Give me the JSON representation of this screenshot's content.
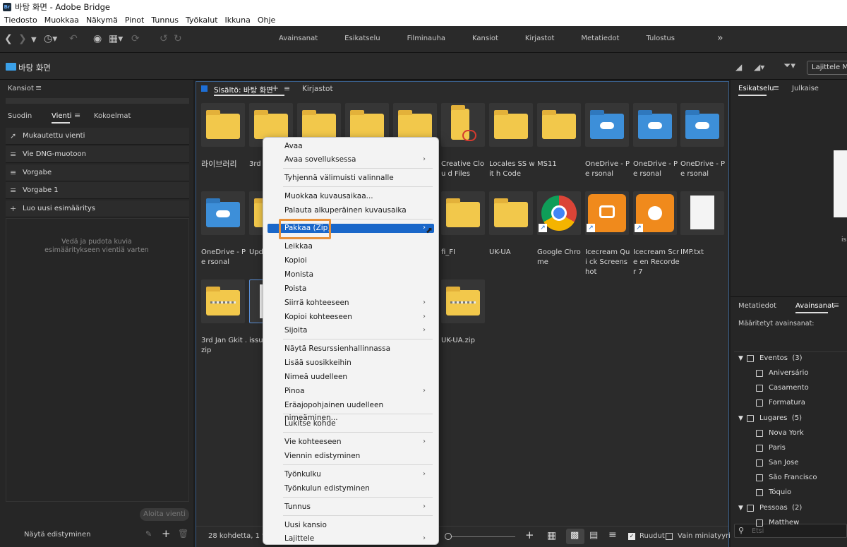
{
  "window": {
    "title": "바탕 화면 - Adobe Bridge",
    "app_icon": "Br"
  },
  "menubar": [
    "Tiedosto",
    "Muokkaa",
    "Näkymä",
    "Pinot",
    "Tunnus",
    "Työkalut",
    "Ikkuna",
    "Ohje"
  ],
  "workspaces": [
    "Avainsanat",
    "Esikatselu",
    "Filminauha",
    "Kansiot",
    "Kirjastot",
    "Metatiedot",
    "Tulostus"
  ],
  "path": {
    "current": "바탕 화면",
    "sort_label": "Lajittele Ma"
  },
  "left": {
    "folders_tab": "Kansiot",
    "tabs": [
      "Suodin",
      "Vienti",
      "Kokoelmat"
    ],
    "export_items": [
      "Mukautettu vienti",
      "Vie DNG-muotoon",
      "Vorgabe",
      "Vorgabe 1",
      "Luo uusi esimääritys"
    ],
    "drop_hint_1": "Vedä ja pudota kuvia",
    "drop_hint_2": "esimääritykseen vientiä varten",
    "start_export": "Aloita vienti",
    "show_progress": "Näytä edistyminen"
  },
  "content": {
    "tab_title": "Sisältö: 바탕 화면",
    "tab_libraries": "Kirjastot",
    "items": [
      {
        "name": "라이브러리",
        "kind": "folder"
      },
      {
        "name": "3rd J",
        "kind": "folder"
      },
      {
        "name": "",
        "kind": "folder"
      },
      {
        "name": "",
        "kind": "folder"
      },
      {
        "name": "",
        "kind": "folder"
      },
      {
        "name": "Creative Clou d Files",
        "kind": "cc-folder"
      },
      {
        "name": "Locales SS wit h Code",
        "kind": "folder"
      },
      {
        "name": "MS11",
        "kind": "folder"
      },
      {
        "name": "OneDrive - Pe rsonal",
        "kind": "onedrive"
      },
      {
        "name": "OneDrive - Pe rsonal",
        "kind": "onedrive"
      },
      {
        "name": "OneDrive - Pe rsonal",
        "kind": "onedrive"
      },
      {
        "name": "OneDrive - Pe rsonal",
        "kind": "onedrive"
      },
      {
        "name": "Upd",
        "kind": "folder"
      },
      {
        "name": "fi_FI",
        "kind": "folder"
      },
      {
        "name": "UK-UA",
        "kind": "folder"
      },
      {
        "name": "Google Chro me",
        "kind": "chrome"
      },
      {
        "name": "Icecream Qui ck Screenshot",
        "kind": "icecream"
      },
      {
        "name": "Icecream Scre en Recorder 7",
        "kind": "icecream"
      },
      {
        "name": "IMP.txt",
        "kind": "file"
      },
      {
        "name": "3rd Jan Gkit .zip",
        "kind": "zip"
      },
      {
        "name": "issue",
        "kind": "file"
      },
      {
        "name": "UK-UA.zip",
        "kind": "zip"
      }
    ],
    "status": "28 kohdetta, 1 valittu",
    "view_options": [
      "Ruudut",
      "Vain miniatyyrit"
    ]
  },
  "right": {
    "tabs_top": [
      "Esikatselu",
      "Julkaise"
    ],
    "tabs_bottom": [
      "Metatiedot",
      "Avainsanat"
    ],
    "assigned_label": "Määritetyt avainsanat:",
    "keywords": [
      {
        "label": "Eventos",
        "count": "(3)",
        "group": true
      },
      {
        "label": "Aniversário"
      },
      {
        "label": "Casamento"
      },
      {
        "label": "Formatura"
      },
      {
        "label": "Lugares",
        "count": "(5)",
        "group": true
      },
      {
        "label": "Nova York"
      },
      {
        "label": "Paris"
      },
      {
        "label": "San Jose"
      },
      {
        "label": "São Francisco"
      },
      {
        "label": "Tóquio"
      },
      {
        "label": "Pessoas",
        "count": "(2)",
        "group": true
      },
      {
        "label": "Matthew"
      }
    ],
    "search_placeholder": "Etsi",
    "preview_partial": "is"
  },
  "context_menu": {
    "items": [
      {
        "label": "Avaa",
        "submenu": false
      },
      {
        "label": "Avaa sovelluksessa",
        "submenu": true
      },
      {
        "label": "Tyhjennä välimuisti valinnalle",
        "submenu": false
      },
      {
        "label": "Muokkaa kuvausaikaa...",
        "submenu": false
      },
      {
        "label": "Palauta alkuperäinen kuvausaika",
        "submenu": false
      },
      {
        "label": "Pakkaa (Zip)",
        "submenu": false
      },
      {
        "label": "Leikkaa",
        "submenu": false
      },
      {
        "label": "Kopioi",
        "submenu": false
      },
      {
        "label": "Monista",
        "submenu": false
      },
      {
        "label": "Poista",
        "submenu": false
      },
      {
        "label": "Siirrä kohteeseen",
        "submenu": true
      },
      {
        "label": "Kopioi kohteeseen",
        "submenu": true
      },
      {
        "label": "Sijoita",
        "submenu": true
      },
      {
        "label": "Näytä Resurssienhallinnassa",
        "submenu": false
      },
      {
        "label": "Lisää suosikkeihin",
        "submenu": false
      },
      {
        "label": "Nimeä uudelleen",
        "submenu": false
      },
      {
        "label": "Pinoa",
        "submenu": true
      },
      {
        "label": "Eräajopohjainen uudelleen nimeäminen...",
        "submenu": false
      },
      {
        "label": "Lukitse kohde",
        "submenu": false
      },
      {
        "label": "Vie kohteeseen",
        "submenu": true
      },
      {
        "label": "Viennin edistyminen",
        "submenu": false
      },
      {
        "label": "Työnkulku",
        "submenu": true
      },
      {
        "label": "Työnkulun edistyminen",
        "submenu": false
      },
      {
        "label": "Tunnus",
        "submenu": true
      },
      {
        "label": "Uusi kansio",
        "submenu": false
      },
      {
        "label": "Lajittele",
        "submenu": true
      }
    ],
    "highlighted": "Pakkaa (Zip)"
  },
  "colors": {
    "highlight": "#1a67c9",
    "callout": "#e8913a",
    "accent": "#3aa0e8"
  }
}
